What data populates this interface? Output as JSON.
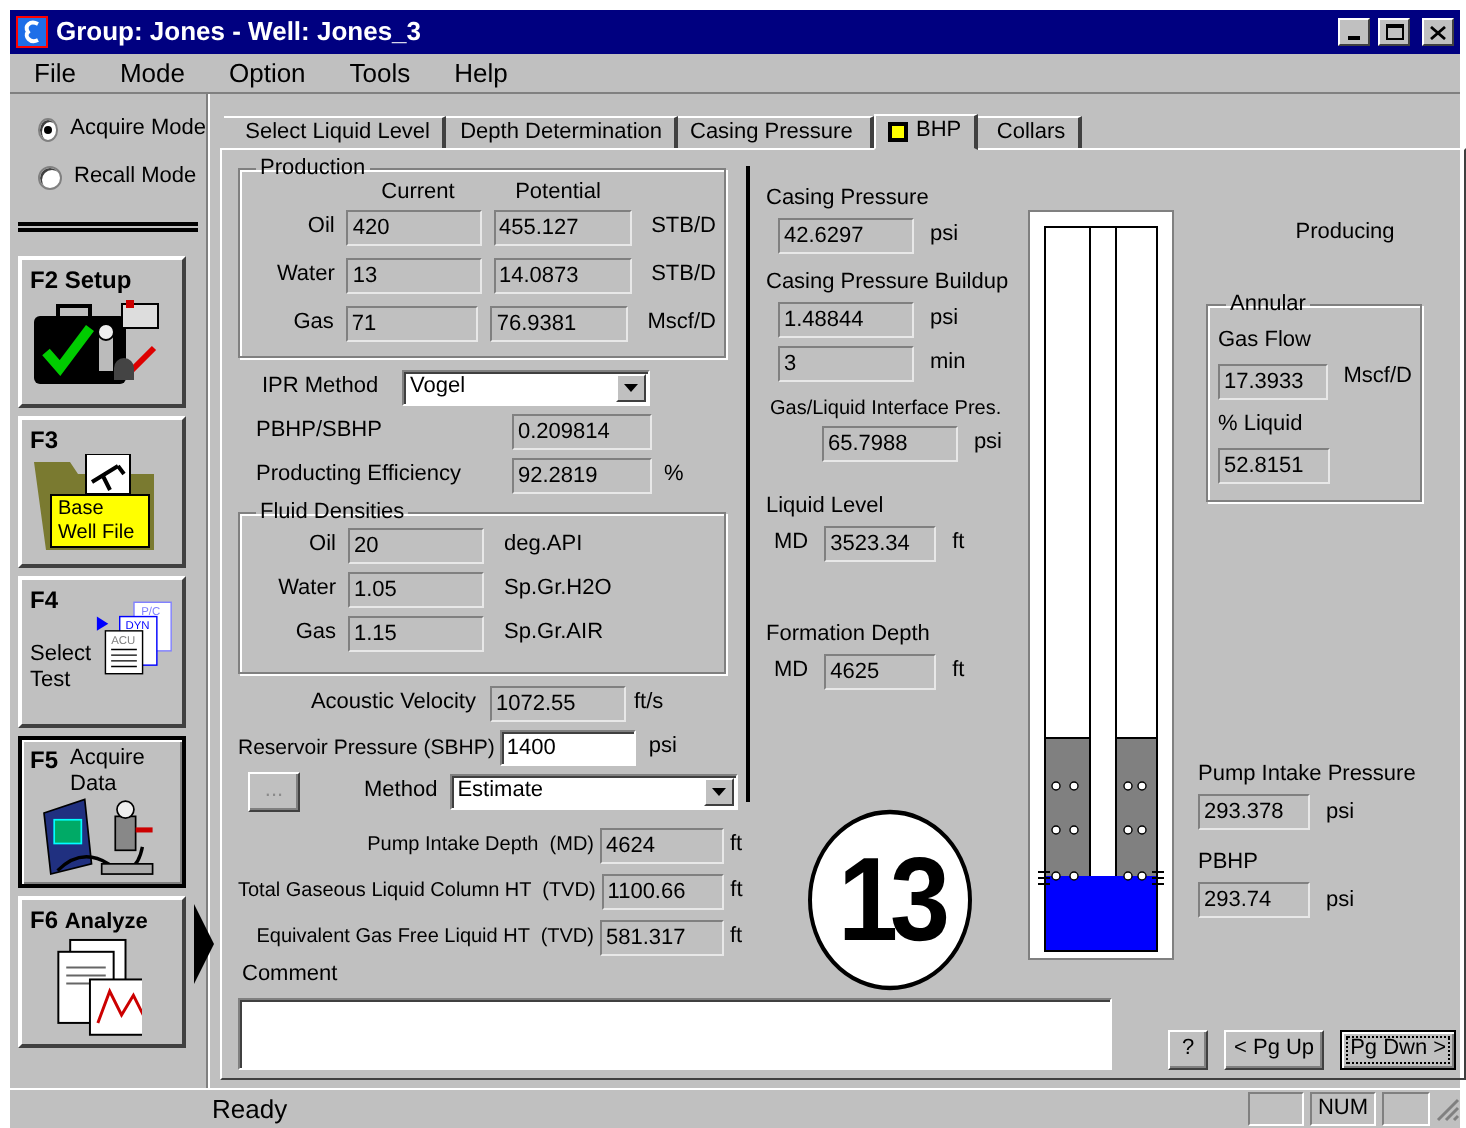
{
  "window": {
    "title": "Group: Jones - Well: Jones_3"
  },
  "menu": [
    "File",
    "Mode",
    "Option",
    "Tools",
    "Help"
  ],
  "modes": [
    {
      "label": "Acquire Mode",
      "selected": true
    },
    {
      "label": "Recall Mode",
      "selected": false
    }
  ],
  "function_buttons": [
    {
      "key": "F2",
      "label": "Setup",
      "kind": "setup",
      "selected": false
    },
    {
      "key": "F3",
      "label": "Base Well File",
      "kind": "well_file",
      "selected": false
    },
    {
      "key": "F4",
      "label": "Select Test",
      "kind": "select_test",
      "selected": false,
      "test_labels": [
        "P/C",
        "DYN",
        "ACU"
      ]
    },
    {
      "key": "F5",
      "label": "Acquire Data",
      "kind": "acquire",
      "selected": true
    },
    {
      "key": "F6",
      "label": "Analyze",
      "kind": "analyze",
      "selected": false
    }
  ],
  "tabs": [
    {
      "label": "Select Liquid Level",
      "selected": false,
      "indicator": false
    },
    {
      "label": "Depth Determination",
      "selected": false,
      "indicator": false
    },
    {
      "label": "Casing Pressure",
      "selected": false,
      "indicator": false
    },
    {
      "label": "BHP",
      "selected": true,
      "indicator": true
    },
    {
      "label": "Collars",
      "selected": false,
      "indicator": false
    }
  ],
  "production": {
    "title": "Production",
    "columns": [
      "Current",
      "Potential"
    ],
    "rows": [
      {
        "label": "Oil",
        "current": "420",
        "potential": "455.127",
        "unit": "STB/D"
      },
      {
        "label": "Water",
        "current": "13",
        "potential": "14.0873",
        "unit": "STB/D"
      },
      {
        "label": "Gas",
        "current": "71",
        "potential": "76.9381",
        "unit": "Mscf/D"
      }
    ]
  },
  "ipr_method": {
    "label": "IPR Method",
    "value": "Vogel"
  },
  "ratios": [
    {
      "label": "PBHP/SBHP",
      "value": "0.209814"
    },
    {
      "label": "Producting Efficiency",
      "value": "92.2819",
      "unit": "%"
    }
  ],
  "fluid_densities": {
    "title": "Fluid Densities",
    "rows": [
      {
        "label": "Oil",
        "value": "20",
        "unit": "deg.API"
      },
      {
        "label": "Water",
        "value": "1.05",
        "unit": "Sp.Gr.H2O"
      },
      {
        "label": "Gas",
        "value": "1.15",
        "unit": "Sp.Gr.AIR"
      }
    ]
  },
  "acoustic_velocity": {
    "label": "Acoustic Velocity",
    "value": "1072.55",
    "unit": "ft/s"
  },
  "reservoir_pressure": {
    "label": "Reservoir Pressure (SBHP)",
    "value": "1400",
    "unit": "psi"
  },
  "method": {
    "button": "...",
    "button_disabled": true,
    "label": "Method",
    "value": "Estimate"
  },
  "depths": [
    {
      "label": "Pump Intake Depth",
      "qualifier": "(MD)",
      "value": "4624",
      "unit": "ft"
    },
    {
      "label": "Total Gaseous Liquid Column HT",
      "qualifier": "(TVD)",
      "value": "1100.66",
      "unit": "ft"
    },
    {
      "label": "Equivalent Gas Free Liquid HT",
      "qualifier": "(TVD)",
      "value": "581.317",
      "unit": "ft"
    }
  ],
  "comment": {
    "label": "Comment"
  },
  "casing_pressure": {
    "label": "Casing Pressure",
    "value": "42.6297",
    "unit": "psi"
  },
  "casing_buildup": {
    "label": "Casing Pressure Buildup",
    "values": [
      {
        "value": "1.48844",
        "unit": "psi"
      },
      {
        "value": "3",
        "unit": "min"
      }
    ]
  },
  "interface_pressure": {
    "label": "Gas/Liquid Interface Pres.",
    "value": "65.7988",
    "unit": "psi"
  },
  "liquid_level": {
    "label": "Liquid Level",
    "prefix": "MD",
    "value": "3523.34",
    "unit": "ft"
  },
  "formation_depth": {
    "label": "Formation Depth",
    "prefix": "MD",
    "value": "4625",
    "unit": "ft"
  },
  "test_number": "13",
  "well_status": "Producing",
  "annular": {
    "title": "Annular",
    "gas_flow": {
      "label": "Gas Flow",
      "value": "17.3933",
      "unit": "Mscf/D"
    },
    "liquid": {
      "label": "% Liquid",
      "value": "52.8151"
    }
  },
  "pump_intake_pressure": {
    "label": "Pump Intake Pressure",
    "value": "293.378",
    "unit": "psi"
  },
  "pbhp": {
    "label": "PBHP",
    "value": "293.74",
    "unit": "psi"
  },
  "buttons": [
    {
      "label": "?",
      "default": false
    },
    {
      "label": "< Pg Up",
      "default": false
    },
    {
      "label": "Pg Dwn >",
      "default": true
    }
  ],
  "status_bar": {
    "message": "Ready",
    "indicators": [
      "NUM"
    ]
  }
}
